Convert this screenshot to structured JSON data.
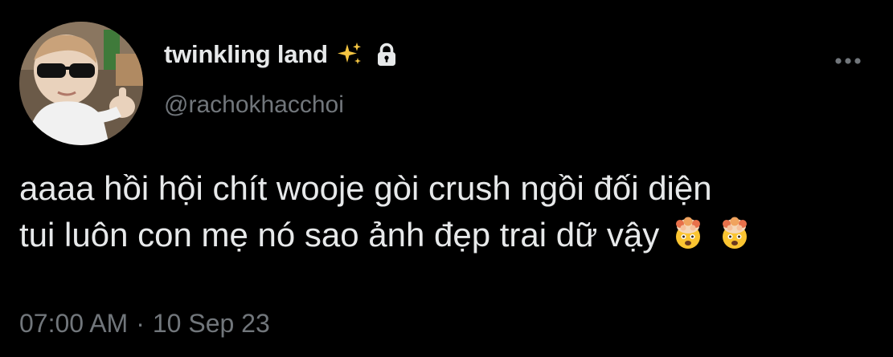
{
  "tweet": {
    "display_name": "twinkling land",
    "handle": "@rachokhacchoi",
    "text_lines": [
      "aaaa hồi hội chít wooje gòi crush ngồi đối diện",
      "tui luôn con mẹ nó sao ảnh đẹp trai dữ vậy"
    ],
    "time": "07:00 AM",
    "separator": "·",
    "date": "10 Sep 23",
    "icons": {
      "badge": "sparkles-icon",
      "protected": "lock-icon",
      "menu": "more-icon",
      "emoji": "exploding-head-icon"
    }
  },
  "colors": {
    "background": "#000000",
    "primary_text": "#e7e9ea",
    "secondary_text": "#71767b"
  }
}
